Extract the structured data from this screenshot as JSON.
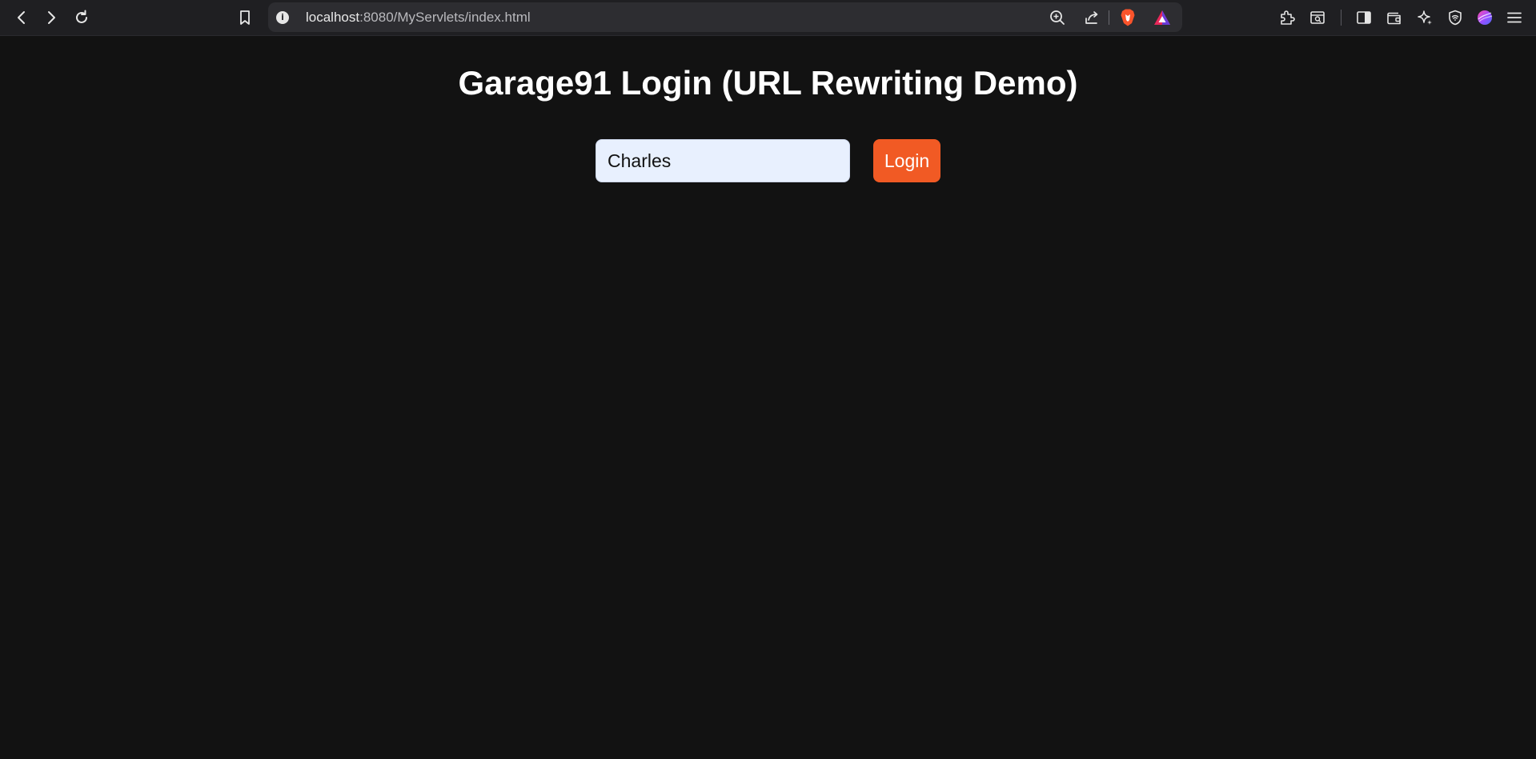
{
  "browser": {
    "url_host": "localhost",
    "url_path": ":8080/MyServlets/index.html",
    "nav_icons": [
      "back-icon",
      "forward-icon",
      "reload-icon",
      "bookmark-icon"
    ],
    "address_icons": [
      "info-icon",
      "zoom-icon",
      "share-icon",
      "brave-shields-icon",
      "brave-rewards-icon"
    ],
    "toolbar_icons": [
      "extensions-icon",
      "screenshot-icon",
      "sidebar-icon",
      "wallet-icon",
      "leo-ai-icon",
      "vpn-icon",
      "profile-icon",
      "menu-icon"
    ],
    "info_glyph": "i"
  },
  "page": {
    "title": "Garage91 Login (URL Rewriting Demo)",
    "form": {
      "username_value": "Charles",
      "login_label": "Login"
    },
    "colors": {
      "background": "#121212",
      "input_background": "#e8f0fe",
      "button": "#f15a24"
    }
  }
}
